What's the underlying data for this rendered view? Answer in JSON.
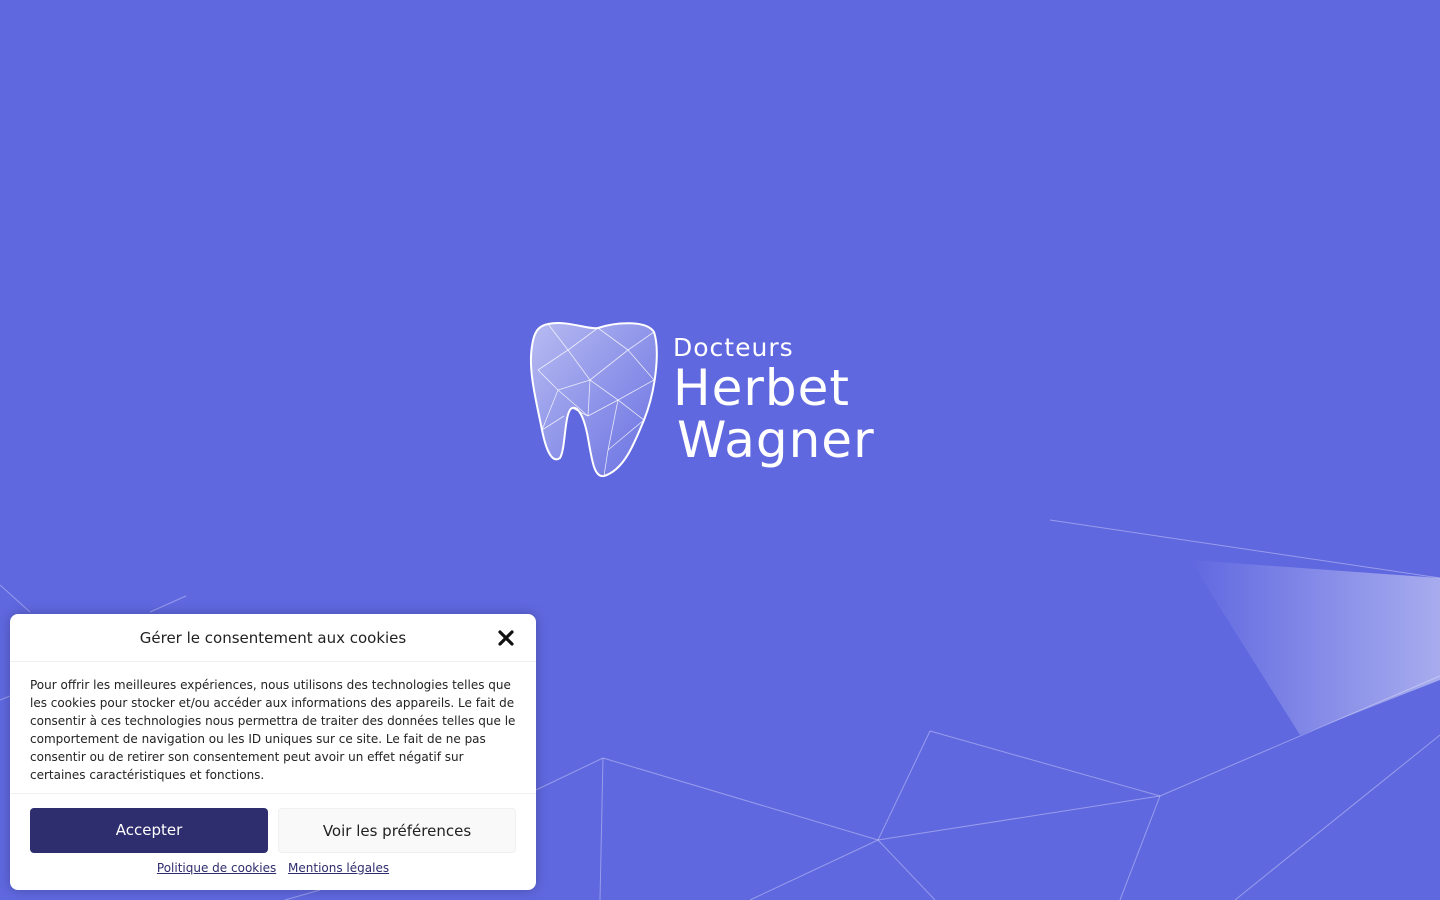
{
  "brand": {
    "subtitle": "Docteurs",
    "name_line1": "Herbet",
    "name_line2": "Wagner"
  },
  "cookie_banner": {
    "title": "Gérer le consentement aux cookies",
    "body": "Pour offrir les meilleures expériences, nous utilisons des technologies telles que les cookies pour stocker et/ou accéder aux informations des appareils. Le fait de consentir à ces technologies nous permettra de traiter des données telles que le comportement de navigation ou les ID uniques sur ce site. Le fait de ne pas consentir ou de retirer son consentement peut avoir un effet négatif sur certaines caractéristiques et fonctions.",
    "accept_label": "Accepter",
    "preferences_label": "Voir les préférences",
    "links": [
      "Politique de cookies",
      "Mentions légales"
    ]
  },
  "colors": {
    "background": "#6068e0",
    "accept_button": "#2e2d6e",
    "text_white": "#ffffff"
  },
  "icons": [
    "tooth-logo-icon",
    "close-icon"
  ]
}
